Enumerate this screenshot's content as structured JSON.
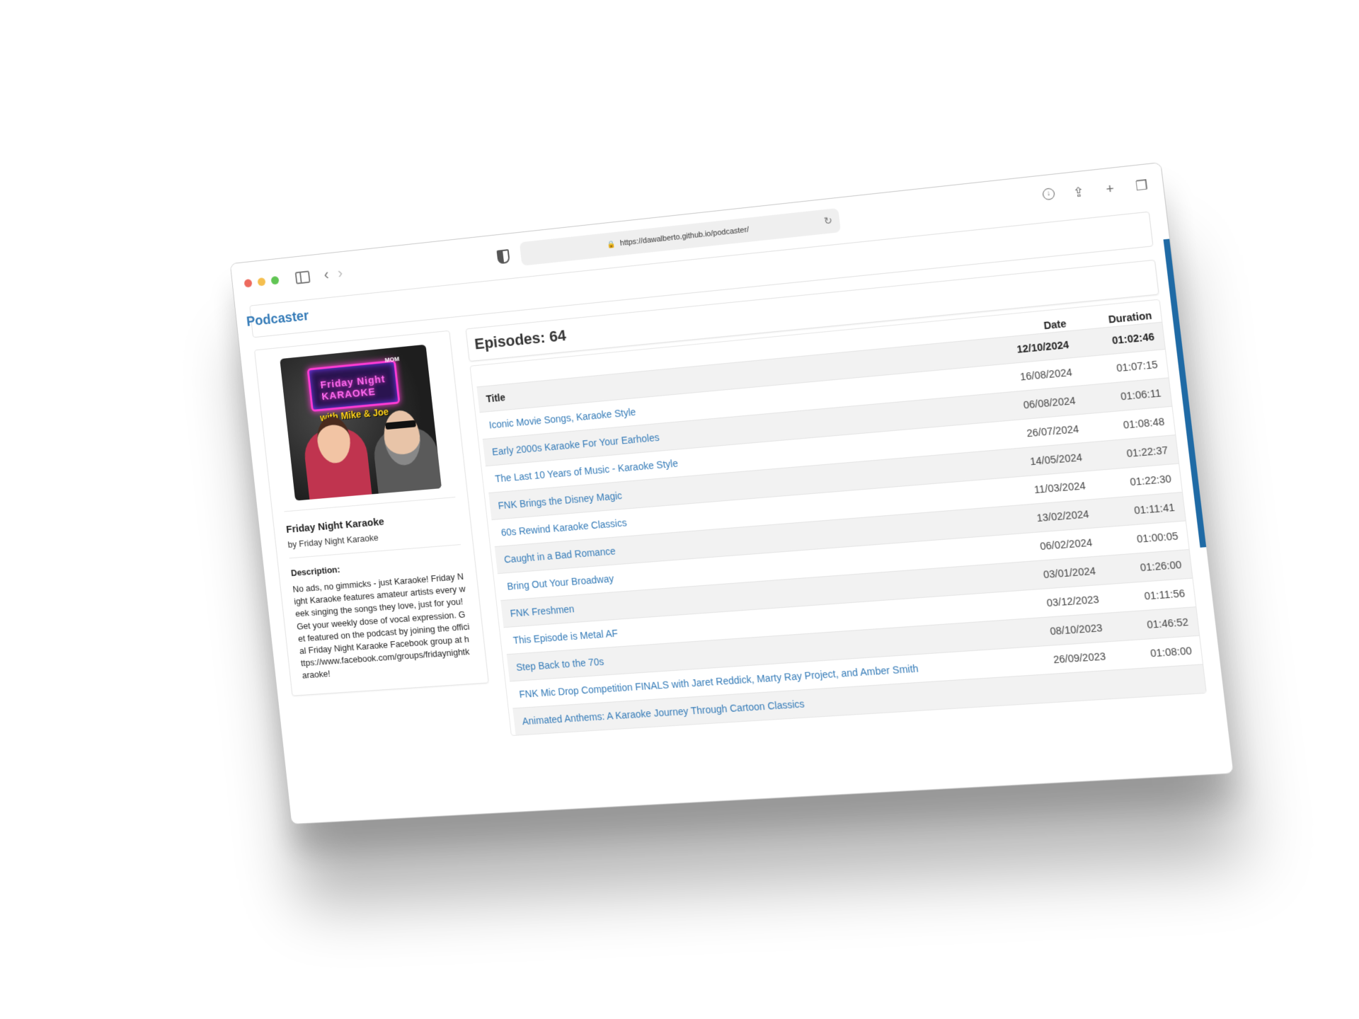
{
  "browser": {
    "url": "https://dawalberto.github.io/podcaster/"
  },
  "app": {
    "brand": "Podcaster"
  },
  "podcast": {
    "title": "Friday Night Karaoke",
    "author": "by Friday Night Karaoke",
    "description_label": "Description:",
    "description": "No ads, no gimmicks - just Karaoke! Friday Night Karaoke features amateur artists every week singing the songs they love, just for you! Get your weekly dose of vocal expression. Get featured on the podcast by joining the official Friday Night Karaoke Facebook group at https://www.facebook.com/groups/fridaynightkaraoke!",
    "cover": {
      "sign_text": "Friday Night KARAOKE",
      "tagline": "with Mike & Joe",
      "badge": "MOM"
    }
  },
  "episodes": {
    "header": "Episodes: 64",
    "columns": {
      "title": "Title",
      "date": "Date",
      "duration": "Duration"
    },
    "rows": [
      {
        "title": "Iconic Movie Songs, Karaoke Style",
        "date": "12/10/2024",
        "duration": "01:02:46"
      },
      {
        "title": "Early 2000s Karaoke For Your Earholes",
        "date": "16/08/2024",
        "duration": "01:07:15"
      },
      {
        "title": "The Last 10 Years of Music - Karaoke Style",
        "date": "06/08/2024",
        "duration": "01:06:11"
      },
      {
        "title": "FNK Brings the Disney Magic",
        "date": "26/07/2024",
        "duration": "01:08:48"
      },
      {
        "title": "60s Rewind Karaoke Classics",
        "date": "14/05/2024",
        "duration": "01:22:37"
      },
      {
        "title": "Caught in a Bad Romance",
        "date": "11/03/2024",
        "duration": "01:22:30"
      },
      {
        "title": "Bring Out Your Broadway",
        "date": "13/02/2024",
        "duration": "01:11:41"
      },
      {
        "title": "FNK Freshmen",
        "date": "06/02/2024",
        "duration": "01:00:05"
      },
      {
        "title": "This Episode is Metal AF",
        "date": "03/01/2024",
        "duration": "01:26:00"
      },
      {
        "title": "Step Back to the 70s",
        "date": "03/12/2023",
        "duration": "01:11:56"
      },
      {
        "title": "FNK Mic Drop Competition FINALS with Jaret Reddick, Marty Ray Project, and Amber Smith",
        "date": "08/10/2023",
        "duration": "01:46:52"
      },
      {
        "title": "Animated Anthems: A Karaoke Journey Through Cartoon Classics",
        "date": "26/09/2023",
        "duration": "01:08:00"
      }
    ]
  },
  "colors": {
    "link": "#337ab7",
    "accent_scrollbar": "#1f6aa5"
  },
  "icons": {
    "download": "download-icon",
    "share": "share-icon",
    "new_tab": "plus-icon",
    "tabs": "tabs-overview-icon"
  }
}
